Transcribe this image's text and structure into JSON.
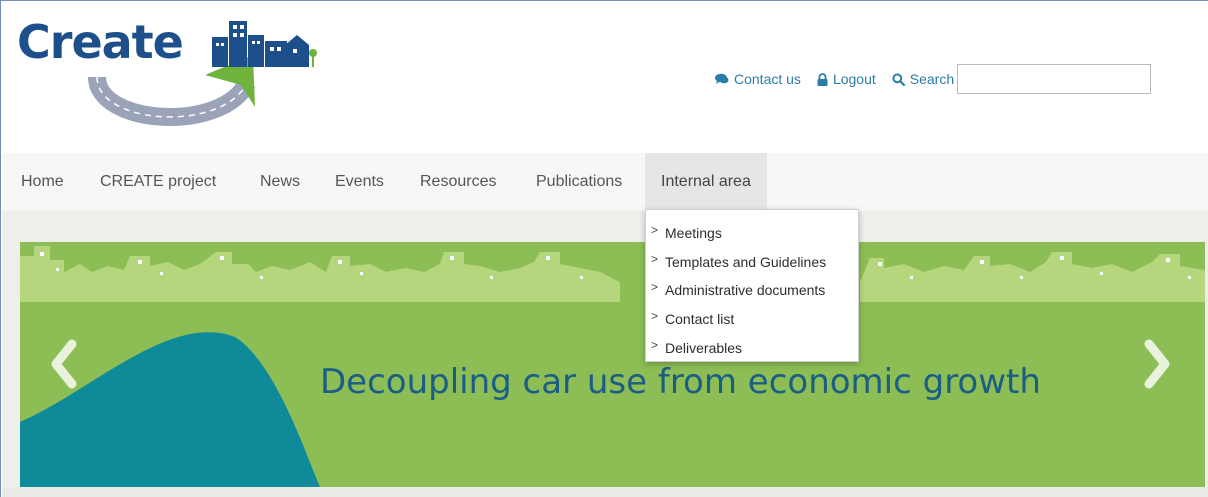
{
  "header": {
    "logo_text": "Create"
  },
  "toolbar": {
    "contact_label": "Contact us",
    "logout_label": "Logout",
    "search_label": "Search",
    "search_value": ""
  },
  "nav": {
    "items": [
      {
        "label": "Home"
      },
      {
        "label": "CREATE project"
      },
      {
        "label": "News"
      },
      {
        "label": "Events"
      },
      {
        "label": "Resources"
      },
      {
        "label": "Publications"
      },
      {
        "label": "Internal area",
        "active": true
      }
    ]
  },
  "dropdown": {
    "caret": ">",
    "items": [
      {
        "label": "Meetings"
      },
      {
        "label": "Templates and Guidelines"
      },
      {
        "label": "Administrative documents"
      },
      {
        "label": "Contact list"
      },
      {
        "label": "Deliverables"
      }
    ]
  },
  "slider": {
    "caption": "Decoupling car use from economic growth"
  },
  "colors": {
    "brand_blue": "#1d4f8a",
    "link_teal": "#2a7da8",
    "slide_green": "#8dbe55",
    "slide_teal": "#0f8a99",
    "caption_blue": "#1b5d85"
  },
  "icons": {
    "contact": "chat-bubble-icon",
    "logout": "lock-icon",
    "search": "magnifier-icon",
    "prev": "chevron-left-icon",
    "next": "chevron-right-icon"
  }
}
